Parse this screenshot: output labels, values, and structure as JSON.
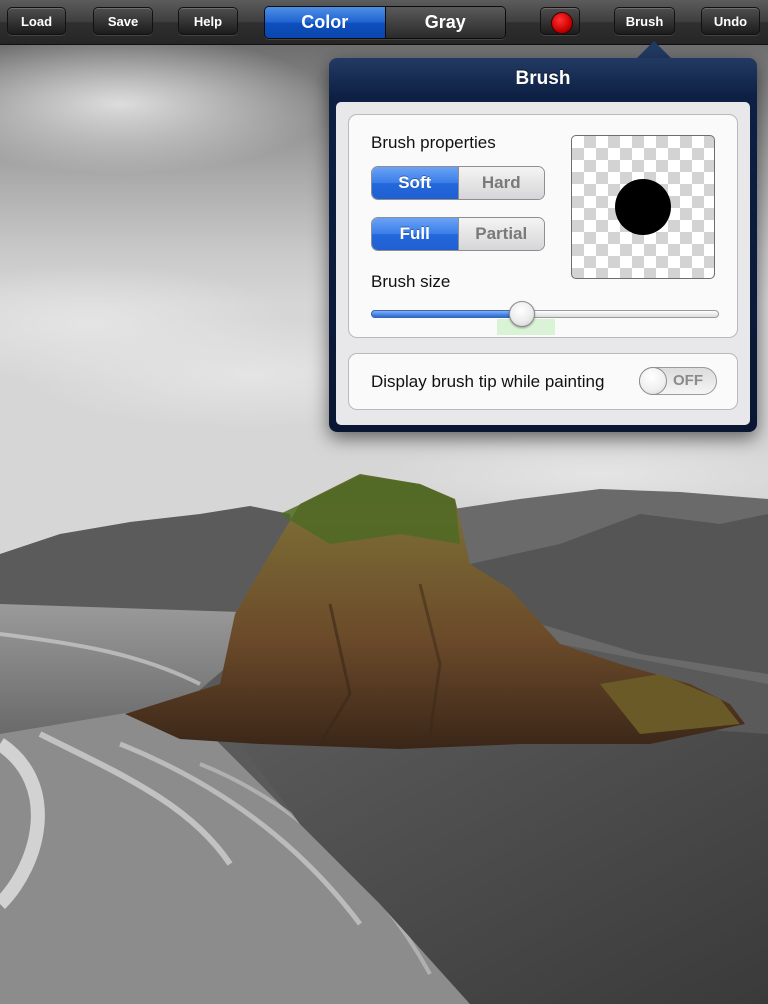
{
  "toolbar": {
    "load_label": "Load",
    "save_label": "Save",
    "help_label": "Help",
    "mode_color_label": "Color",
    "mode_gray_label": "Gray",
    "mode_selected": "Color",
    "paint_color": "#cc0000",
    "brush_label": "Brush",
    "undo_label": "Undo"
  },
  "brush_popover": {
    "title": "Brush",
    "properties_label": "Brush properties",
    "hardness": {
      "option_1": "Soft",
      "option_2": "Hard",
      "selected": "Soft"
    },
    "coverage": {
      "option_1": "Full",
      "option_2": "Partial",
      "selected": "Full"
    },
    "size_label": "Brush size",
    "size_value": 0.43,
    "display_tip_label": "Display brush tip while painting",
    "display_tip_state": "OFF"
  },
  "colors": {
    "accent_blue": "#2468db",
    "popover_header": "#0d1f43"
  }
}
